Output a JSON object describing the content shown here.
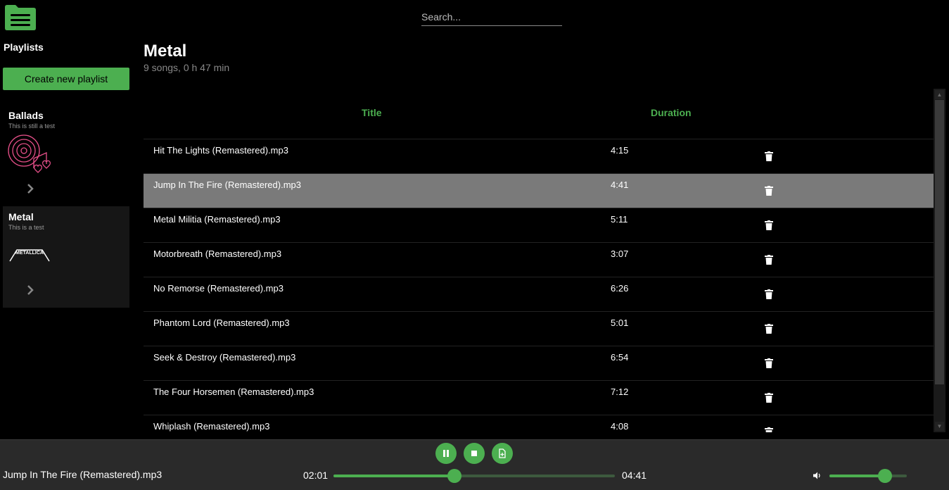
{
  "search": {
    "placeholder": "Search..."
  },
  "sidebar": {
    "title": "Playlists",
    "create_label": "Create new playlist",
    "playlists": [
      {
        "name": "Ballads",
        "description": "This is still a test",
        "active": false
      },
      {
        "name": "Metal",
        "description": "This is a test",
        "active": true,
        "art_text": "METALLICA"
      }
    ]
  },
  "playlist": {
    "title": "Metal",
    "info": "9 songs, 0 h 47 min",
    "columns": {
      "title": "Title",
      "duration": "Duration"
    },
    "songs": [
      {
        "title": "Hit The Lights (Remastered).mp3",
        "duration": "4:15"
      },
      {
        "title": "Jump In The Fire (Remastered).mp3",
        "duration": "4:41",
        "selected": true
      },
      {
        "title": "Metal Militia (Remastered).mp3",
        "duration": "5:11"
      },
      {
        "title": "Motorbreath (Remastered).mp3",
        "duration": "3:07"
      },
      {
        "title": "No Remorse (Remastered).mp3",
        "duration": "6:26"
      },
      {
        "title": "Phantom Lord (Remastered).mp3",
        "duration": "5:01"
      },
      {
        "title": "Seek & Destroy (Remastered).mp3",
        "duration": "6:54"
      },
      {
        "title": "The Four Horsemen (Remastered).mp3",
        "duration": "7:12"
      },
      {
        "title": "Whiplash (Remastered).mp3",
        "duration": "4:08"
      }
    ]
  },
  "player": {
    "now_playing": "Jump In The Fire (Remastered).mp3",
    "current_time": "02:01",
    "total_time": "04:41",
    "progress_fraction": 0.43,
    "volume_fraction": 0.72,
    "controls": [
      "pause-icon",
      "stop-icon",
      "add-file-icon"
    ]
  },
  "colors": {
    "accent": "#4caf50",
    "selected_row": "#7a7a7a",
    "player_bg": "#2a2a2a",
    "ballads_art": "#e8508a"
  }
}
